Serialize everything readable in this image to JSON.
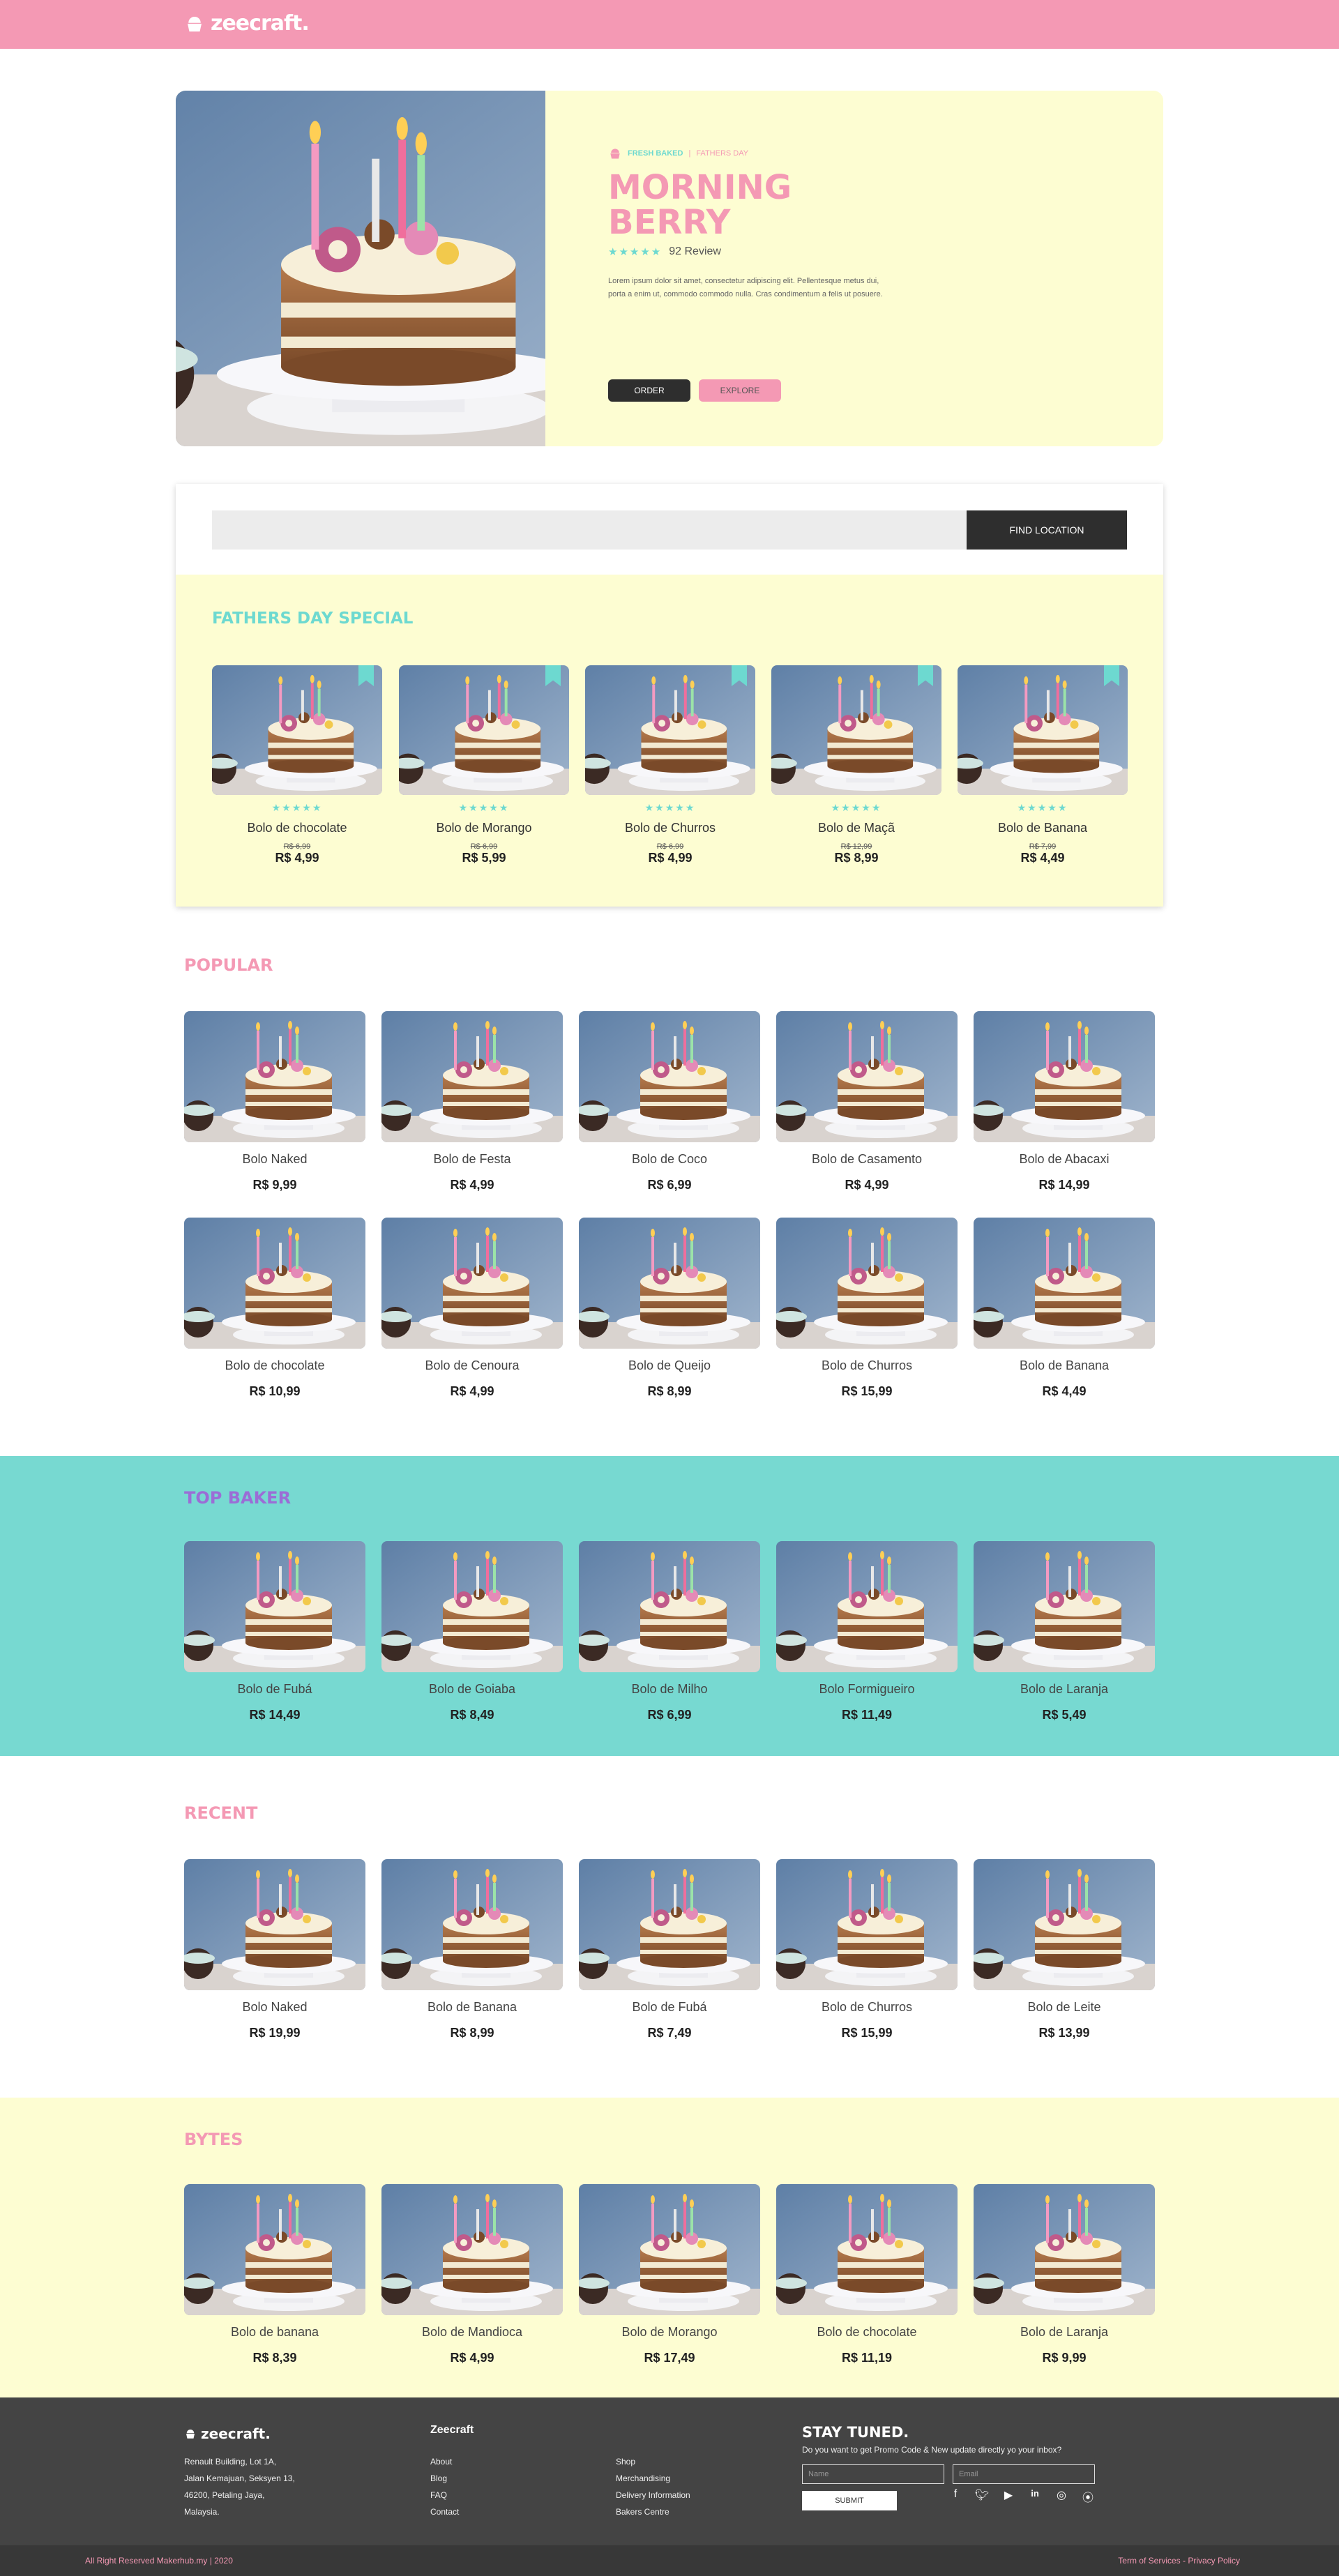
{
  "brand": {
    "logo_text": "zeecraft.",
    "footer_logo_text": "zeecraft."
  },
  "colors": {
    "pink": "#f499b4",
    "teal": "#6dd9d0",
    "cream": "#fdfdd2",
    "dark": "#2e2e2e",
    "footer": "#444444"
  },
  "hero": {
    "tag": "FRESH BAKED",
    "tag_separator": "|",
    "tag_sub": "FATHERS DAY",
    "title_line1": "MORNING",
    "title_line2": "BERRY",
    "stars": "★★★★★",
    "rating": 4.5,
    "reviews": "92 Review",
    "description": "Lorem ipsum dolor sit amet, consectetur adipiscing elit. Pellentesque metus dui, porta a enim ut, commodo commodo nulla. Cras condimentum a felis ut posuere.",
    "order_label": "ORDER",
    "explore_label": "EXPLORE"
  },
  "search": {
    "placeholder": "",
    "button_label": "FIND LOCATION"
  },
  "fathers_day": {
    "title": "FATHERS DAY SPECIAL",
    "items": [
      {
        "name": "Bolo de chocolate",
        "old_price": "R$ 6,99",
        "price": "R$ 4,99",
        "stars": "★★★★★",
        "rating": 4
      },
      {
        "name": "Bolo de Morango",
        "old_price": "R$ 6,99",
        "price": "R$ 5,99",
        "stars": "★★★★★",
        "rating": 4
      },
      {
        "name": "Bolo de Churros",
        "old_price": "R$ 6,99",
        "price": "R$ 4,99",
        "stars": "★★★★★",
        "rating": 4
      },
      {
        "name": "Bolo de Maçã",
        "old_price": "R$ 12,99",
        "price": "R$ 8,99",
        "stars": "★★★★★",
        "rating": 4
      },
      {
        "name": "Bolo de Banana",
        "old_price": "R$ 7,99",
        "price": "R$ 4,49",
        "stars": "★★★★★",
        "rating": 4
      }
    ]
  },
  "popular": {
    "title": "POPULAR",
    "items": [
      {
        "name": "Bolo Naked",
        "price": "R$ 9,99"
      },
      {
        "name": "Bolo de Festa",
        "price": "R$ 4,99"
      },
      {
        "name": "Bolo de Coco",
        "price": "R$ 6,99"
      },
      {
        "name": "Bolo de Casamento",
        "price": "R$ 4,99"
      },
      {
        "name": "Bolo de Abacaxi",
        "price": "R$ 14,99"
      },
      {
        "name": "Bolo de chocolate",
        "price": "R$ 10,99"
      },
      {
        "name": "Bolo de Cenoura",
        "price": "R$ 4,99"
      },
      {
        "name": "Bolo de Queijo",
        "price": "R$ 8,99"
      },
      {
        "name": "Bolo de Churros",
        "price": "R$ 15,99"
      },
      {
        "name": "Bolo de Banana",
        "price": "R$ 4,49"
      }
    ]
  },
  "top_baker": {
    "title": "TOP BAKER",
    "items": [
      {
        "name": "Bolo de Fubá",
        "price": "R$ 14,49"
      },
      {
        "name": "Bolo de Goiaba",
        "price": "R$ 8,49"
      },
      {
        "name": "Bolo de Milho",
        "price": "R$ 6,99"
      },
      {
        "name": "Bolo Formigueiro",
        "price": "R$ 11,49"
      },
      {
        "name": "Bolo de Laranja",
        "price": "R$ 5,49"
      }
    ]
  },
  "recent": {
    "title": "RECENT",
    "items": [
      {
        "name": "Bolo Naked",
        "price": "R$ 19,99"
      },
      {
        "name": "Bolo de Banana",
        "price": "R$ 8,99"
      },
      {
        "name": "Bolo de Fubá",
        "price": "R$ 7,49"
      },
      {
        "name": "Bolo de Churros",
        "price": "R$ 15,99"
      },
      {
        "name": "Bolo de Leite",
        "price": "R$ 13,99"
      }
    ]
  },
  "bytes": {
    "title": "BYTES",
    "items": [
      {
        "name": "Bolo de banana",
        "price": "R$ 8,39"
      },
      {
        "name": "Bolo de Mandioca",
        "price": "R$ 4,99"
      },
      {
        "name": "Bolo de Morango",
        "price": "R$ 17,49"
      },
      {
        "name": "Bolo de chocolate",
        "price": "R$ 11,19"
      },
      {
        "name": "Bolo de Laranja",
        "price": "R$ 9,99"
      }
    ]
  },
  "footer": {
    "address": [
      "Renault Building, Lot 1A,",
      "Jalan Kemajuan, Seksyen 13,",
      "46200, Petaling Jaya,",
      "Malaysia."
    ],
    "col1_title": "Zeecraft",
    "col1_links": [
      "About",
      "Blog",
      "FAQ",
      "Contact"
    ],
    "col2_links": [
      "Shop",
      "Merchandising",
      "Delivery Information",
      "Bakers Centre"
    ],
    "stay_title": "STAY TUNED.",
    "stay_sub": "Do you want to get Promo Code & New update directly yo your inbox?",
    "name_placeholder": "Name",
    "email_placeholder": "Email",
    "submit_label": "SUBMIT",
    "social_icons": [
      "facebook-icon",
      "twitter-icon",
      "youtube-icon",
      "linkedin-icon",
      "instagram-icon",
      "rss-icon"
    ],
    "copyright": "All Right Reserved Makerhub.my | 2020",
    "legal": "Term of Services - Privacy Policy"
  }
}
